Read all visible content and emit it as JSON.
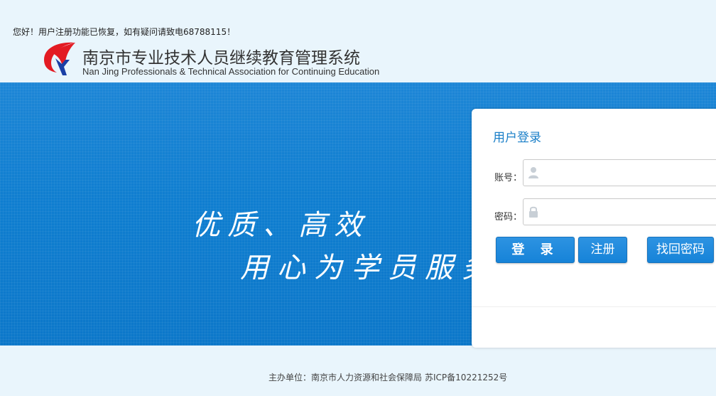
{
  "header": {
    "notice": "您好！用户注册功能已恢复，如有疑问请致电68788115！",
    "title": "南京市专业技术人员继续教育管理系统",
    "subtitle": "Nan Jing Professionals & Technical Association for Continuing Education"
  },
  "banner": {
    "slogan_line1": "优质、高效",
    "slogan_line2": "用心为学员服务"
  },
  "login": {
    "title": "用户登录",
    "account_label": "账号：",
    "account_value": "",
    "password_label": "密码：",
    "password_value": "",
    "login_button": "登 录",
    "register_button": "注册",
    "find_password_button": "找回密码"
  },
  "footer": {
    "organizer": "主办单位：南京市人力资源和社会保障局",
    "icp": "苏ICP备10221252号"
  },
  "colors": {
    "banner_blue": "#0f7ed0",
    "button_blue": "#1683d8",
    "title_blue": "#1a7fc8",
    "page_bg": "#e9f5fc"
  }
}
